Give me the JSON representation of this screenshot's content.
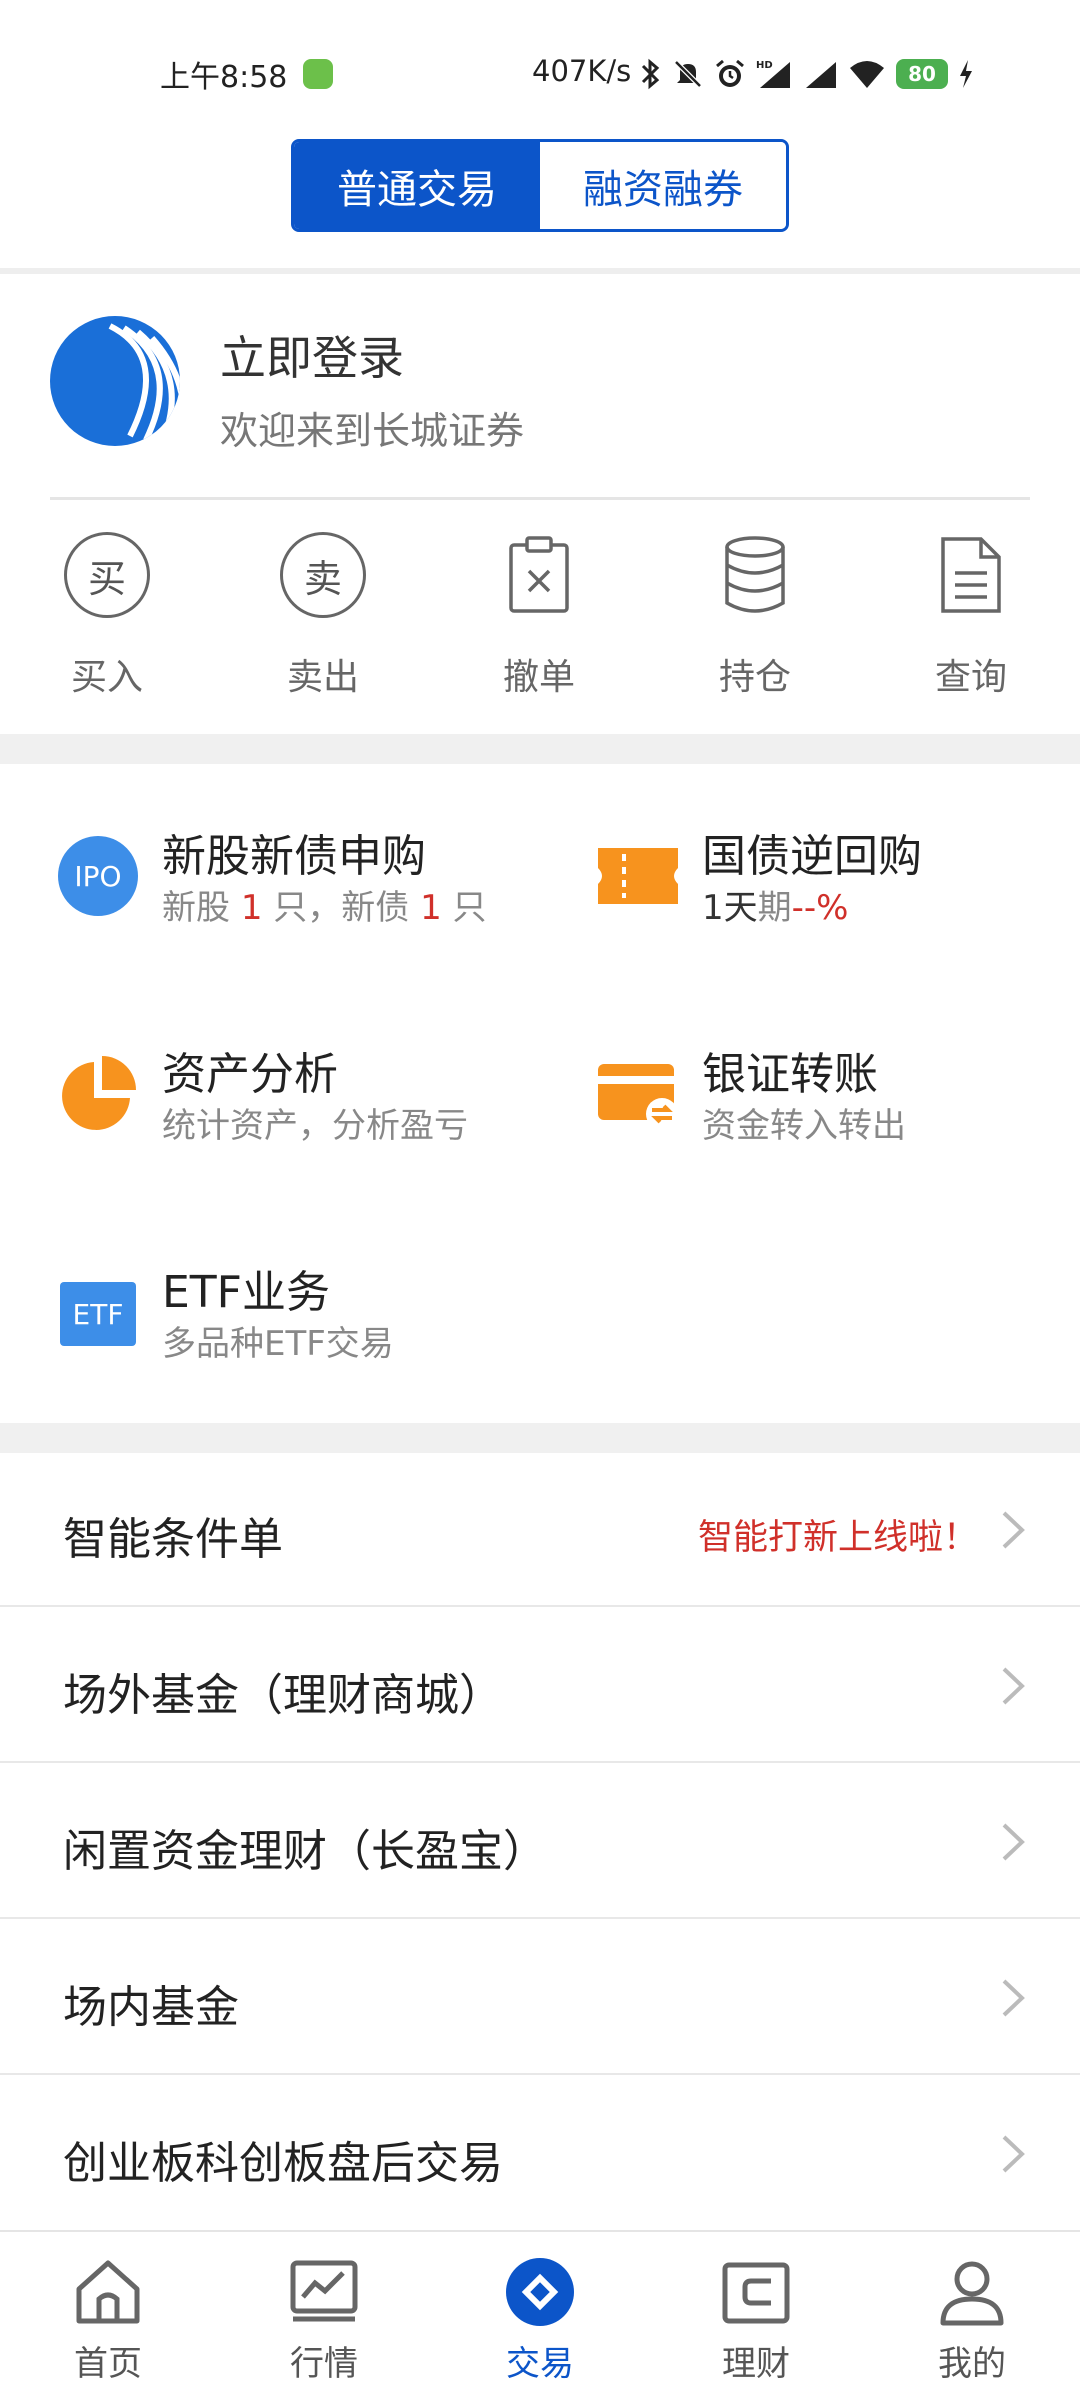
{
  "status_bar": {
    "time": "上午8:58",
    "net_speed": "407K/s",
    "battery": "80",
    "icons": [
      "bluetooth-icon",
      "mute-icon",
      "alarm-icon",
      "hd-signal-icon",
      "signal-icon",
      "wifi-icon",
      "battery-icon",
      "charging-icon"
    ]
  },
  "segment": {
    "tabs": [
      "普通交易",
      "融资融券"
    ],
    "active": 0
  },
  "login": {
    "title": "立即登录",
    "subtitle": "欢迎来到长城证券"
  },
  "actions": [
    {
      "label": "买入",
      "glyph": "买",
      "icon": "buy-icon"
    },
    {
      "label": "卖出",
      "glyph": "卖",
      "icon": "sell-icon"
    },
    {
      "label": "撤单",
      "icon": "cancel-order-icon"
    },
    {
      "label": "持仓",
      "icon": "holdings-icon"
    },
    {
      "label": "查询",
      "icon": "query-icon"
    }
  ],
  "features": {
    "ipo": {
      "title": "新股新债申购",
      "icon_text": "IPO",
      "sub_a": "新股 ",
      "stock_count": "1",
      "sub_b": " 只，新债 ",
      "bond_count": "1",
      "sub_c": " 只"
    },
    "repo": {
      "title": "国债逆回购",
      "term": "1天",
      "period": "期",
      "rate": "--%"
    },
    "asset": {
      "title": "资产分析",
      "subtitle": "统计资产，分析盈亏"
    },
    "transfer": {
      "title": "银证转账",
      "subtitle": "资金转入转出"
    },
    "etf": {
      "title": "ETF业务",
      "icon_text": "ETF",
      "subtitle": "多品种ETF交易"
    }
  },
  "list": [
    {
      "label": "智能条件单",
      "extra": "智能打新上线啦！"
    },
    {
      "label": "场外基金（理财商城）"
    },
    {
      "label": "闲置资金理财（长盈宝）"
    },
    {
      "label": "场内基金"
    },
    {
      "label": "创业板科创板盘后交易"
    }
  ],
  "nav": [
    {
      "label": "首页",
      "icon": "home-icon"
    },
    {
      "label": "行情",
      "icon": "market-icon"
    },
    {
      "label": "交易",
      "icon": "trade-icon"
    },
    {
      "label": "理财",
      "icon": "wallet-icon"
    },
    {
      "label": "我的",
      "icon": "profile-icon"
    }
  ],
  "colors": {
    "primary": "#0c55c9",
    "accent_orange": "#f7931e",
    "alert_red": "#d0302a",
    "ipo_blue": "#3d8ee8"
  }
}
